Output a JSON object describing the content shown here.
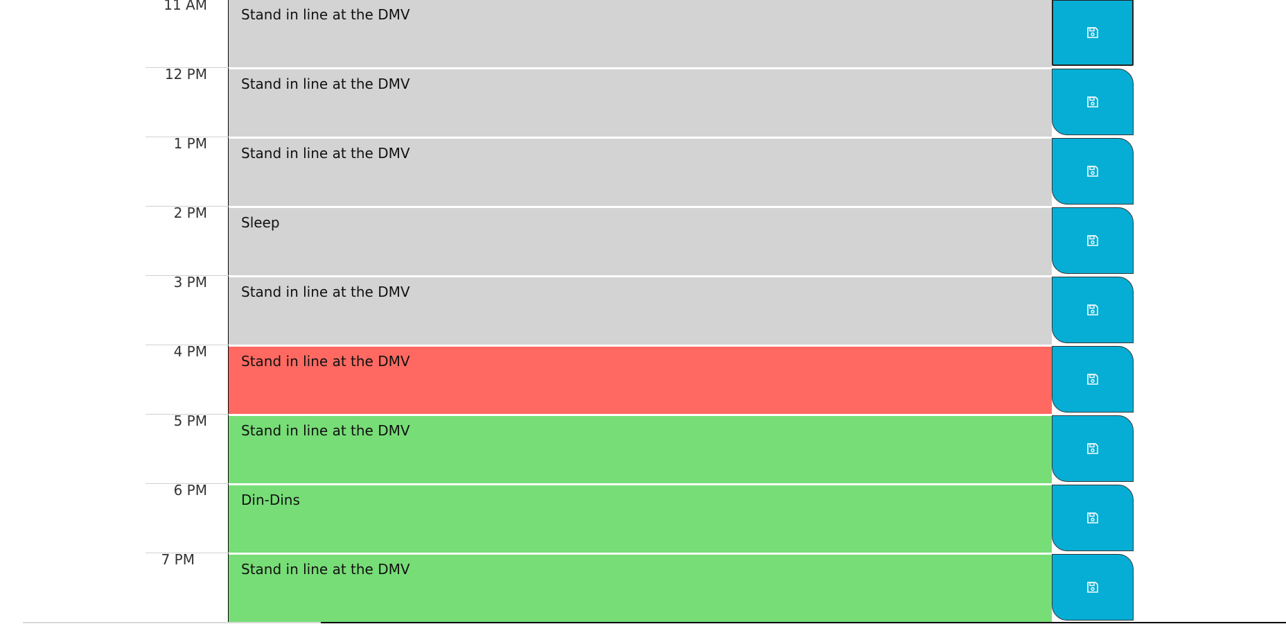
{
  "schedule": {
    "rows": [
      {
        "hour": "11 AM",
        "text": "Stand in line at the DMV",
        "state": "past"
      },
      {
        "hour": "12 PM",
        "text": "Stand in line at the DMV",
        "state": "past"
      },
      {
        "hour": "1 PM",
        "text": "Stand in line at the DMV",
        "state": "past"
      },
      {
        "hour": "2 PM",
        "text": "Sleep",
        "state": "past"
      },
      {
        "hour": "3 PM",
        "text": "Stand in line at the DMV",
        "state": "past"
      },
      {
        "hour": "4 PM",
        "text": "Stand in line at the DMV",
        "state": "present"
      },
      {
        "hour": "5 PM",
        "text": "Stand in line at the DMV",
        "state": "future"
      },
      {
        "hour": "6 PM",
        "text": "Din-Dins",
        "state": "future"
      },
      {
        "hour": "7 PM",
        "text": "Stand in line at the DMV",
        "state": "future"
      }
    ],
    "save_icon": "floppy-disk-icon"
  },
  "colors": {
    "past": "#d3d3d3",
    "present": "#ff6961",
    "future": "#77dd77",
    "save_button": "#06aed5"
  }
}
